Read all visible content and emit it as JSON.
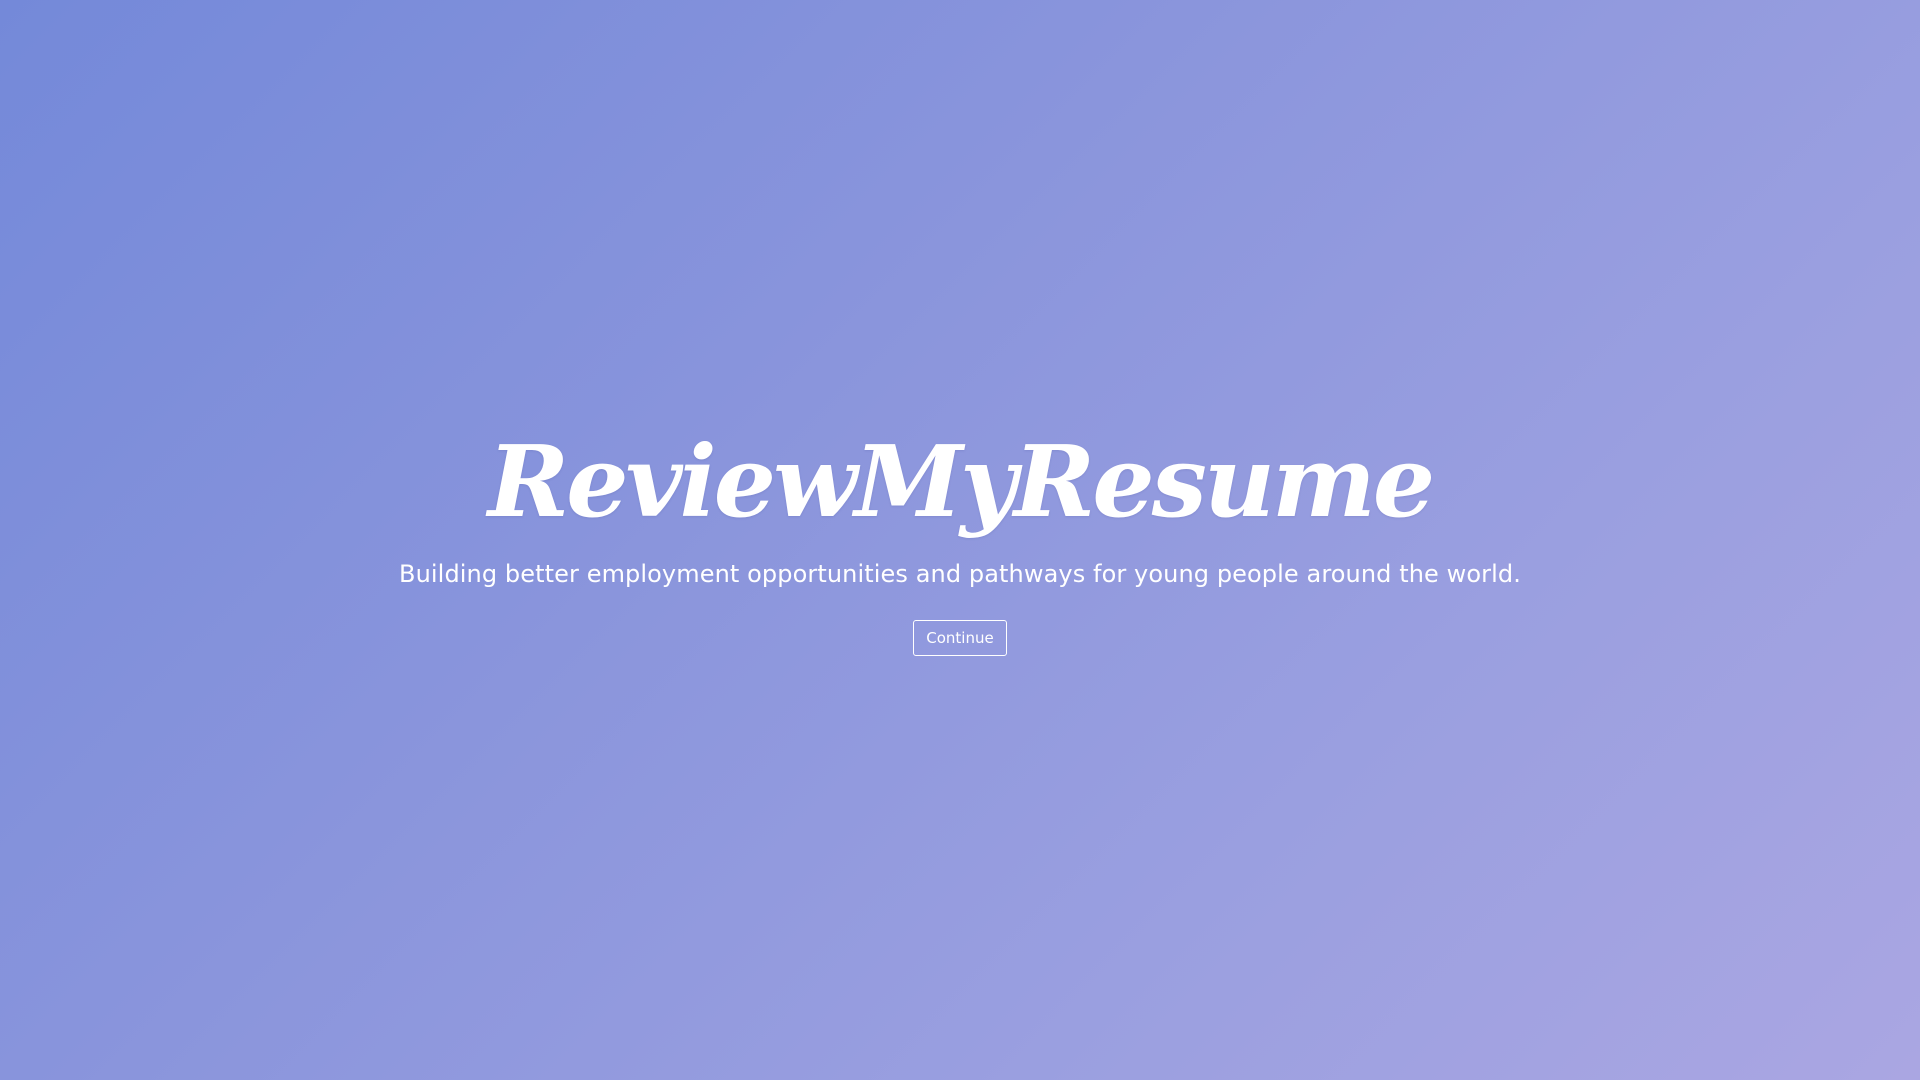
{
  "colors": {
    "background_start": "#7489d9",
    "background_end": "#aaa6e2",
    "text": "#ffffff"
  },
  "hero": {
    "brand": "ReviewMyResume",
    "tagline": "Building better employment opportunities and pathways for young people around the world.",
    "continue_label": "Continue"
  }
}
